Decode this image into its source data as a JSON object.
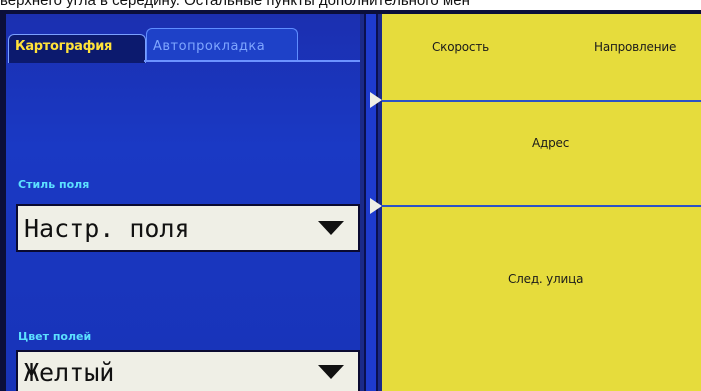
{
  "caption": "верхнего угла в середину. Остальные пункты дополнительного мен",
  "tabs": [
    {
      "label": "Картография",
      "active": true
    },
    {
      "label": "Автопрокладка",
      "active": false
    }
  ],
  "fields": {
    "style": {
      "label": "Стиль поля",
      "value": "Настр. поля"
    },
    "color": {
      "label": "Цвет полей",
      "value": "Желтый"
    }
  },
  "data_fields": {
    "speed": "Скорость",
    "direction": "Напровление",
    "address": "Адрес",
    "next_street": "След. улица"
  },
  "colors": {
    "panel_blue": "#1a39c4",
    "field_yellow": "#e6dc3c",
    "label_cyan": "#5ce0ff",
    "tab_text_yellow": "#ffe23a"
  }
}
